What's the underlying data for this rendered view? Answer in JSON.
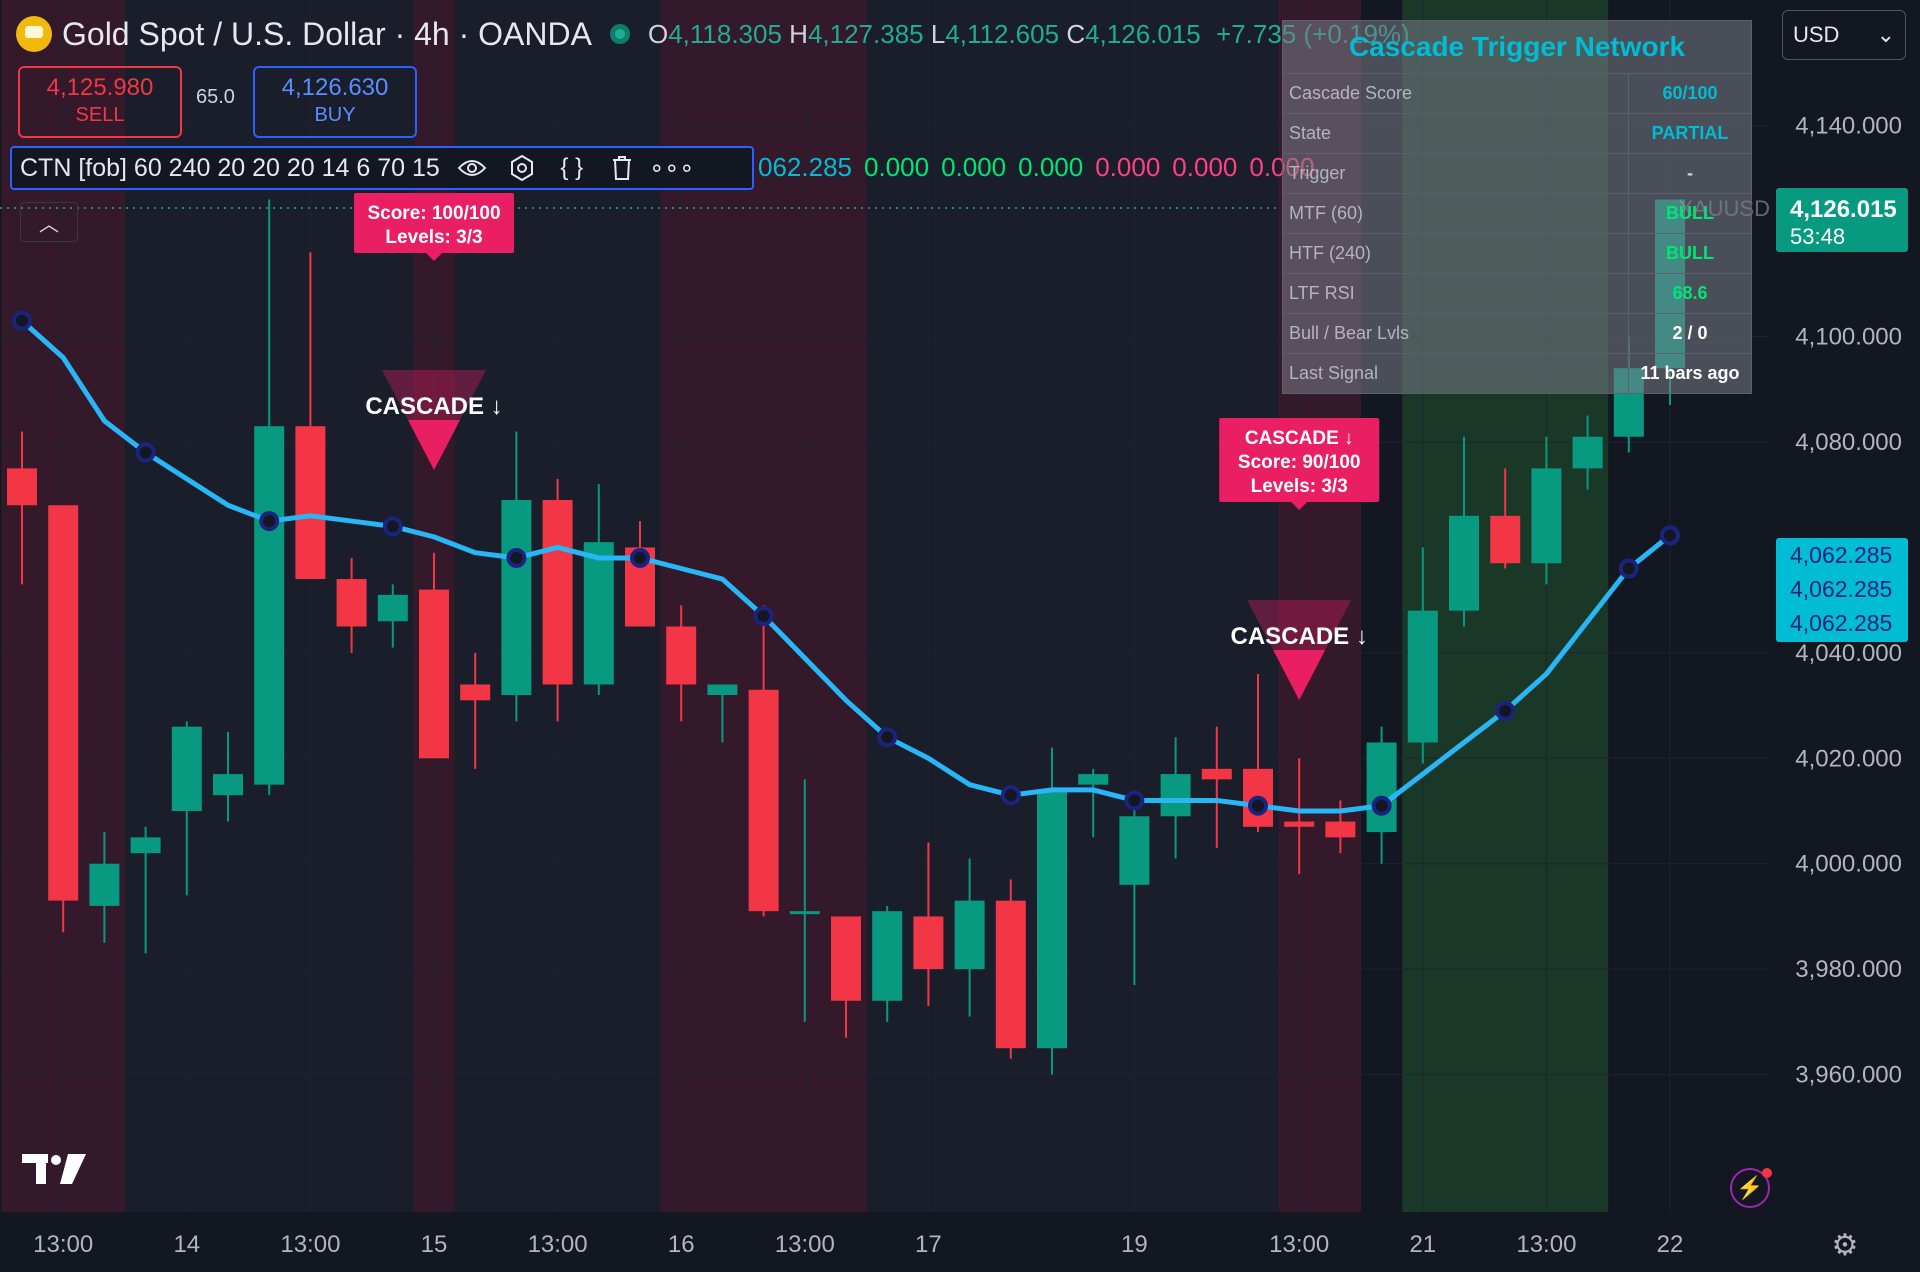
{
  "header": {
    "symbol": "Gold Spot / U.S. Dollar · 4h · OANDA",
    "open_label": "O",
    "open": "4,118.305",
    "high_label": "H",
    "high": "4,127.385",
    "low_label": "L",
    "low": "4,112.605",
    "close_label": "C",
    "close": "4,126.015",
    "change": "+7.735 (+0.19%)"
  },
  "trade": {
    "sell_price": "4,125.980",
    "sell_label": "SELL",
    "spread": "65.0",
    "buy_price": "4,126.630",
    "buy_label": "BUY"
  },
  "indicator": {
    "name": "CTN [fob] 60 240 20 20 20 14 6 70 15",
    "values": [
      "062.285",
      "0.000",
      "0.000",
      "0.000",
      "0.000",
      "0.000",
      "0.000"
    ],
    "value_colors": [
      "#00bcd4",
      "#00e676",
      "#00e676",
      "#00e676",
      "#ff4081",
      "#ff4081",
      "#ff4081"
    ]
  },
  "currency": {
    "label": "USD"
  },
  "table": {
    "title": "Cascade Trigger Network",
    "rows": [
      {
        "label": "Cascade Score",
        "value": "60/100",
        "color": "#00bcd4"
      },
      {
        "label": "State",
        "value": "PARTIAL",
        "color": "#00bcd4"
      },
      {
        "label": "Trigger",
        "value": "-",
        "color": "#d1d4dc"
      },
      {
        "label": "MTF (60)",
        "value": "BULL",
        "color": "#00e676"
      },
      {
        "label": "HTF (240)",
        "value": "BULL",
        "color": "#00e676"
      },
      {
        "label": "LTF RSI",
        "value": "68.6",
        "color": "#00e676"
      },
      {
        "label": "Bull / Bear Lvls",
        "value": "2 / 0",
        "color": "#ffffff"
      },
      {
        "label": "Last Signal",
        "value": "11 bars ago",
        "color": "#ffffff"
      }
    ]
  },
  "price_labels": {
    "last_price": "4,126.015",
    "countdown": "53:48",
    "ema_values": [
      "4,062.285",
      "4,062.285",
      "4,062.285"
    ],
    "symbol_ghost": "XAUUSD"
  },
  "chart_data": {
    "type": "candlestick",
    "y_ticks": [
      "4,140.000",
      "4,100.000",
      "4,080.000",
      "4,040.000",
      "4,020.000",
      "4,000.000",
      "3,980.000",
      "3,960.000"
    ],
    "y_tick_values": [
      4140,
      4100,
      4080,
      4040,
      4020,
      4000,
      3980,
      3960
    ],
    "x_ticks": [
      {
        "label": "13:00",
        "i": 1
      },
      {
        "label": "14",
        "i": 4
      },
      {
        "label": "13:00",
        "i": 7
      },
      {
        "label": "15",
        "i": 10
      },
      {
        "label": "13:00",
        "i": 13
      },
      {
        "label": "16",
        "i": 16
      },
      {
        "label": "13:00",
        "i": 19
      },
      {
        "label": "17",
        "i": 22
      },
      {
        "label": "19",
        "i": 27
      },
      {
        "label": "13:00",
        "i": 31
      },
      {
        "label": "21",
        "i": 34
      },
      {
        "label": "13:00",
        "i": 37
      },
      {
        "label": "22",
        "i": 40
      }
    ],
    "candles": [
      {
        "o": 4075,
        "h": 4082,
        "l": 4053,
        "c": 4068
      },
      {
        "o": 4068,
        "h": 4068,
        "l": 3987,
        "c": 3993
      },
      {
        "o": 3992,
        "h": 4006,
        "l": 3985,
        "c": 4000
      },
      {
        "o": 4002,
        "h": 4007,
        "l": 3983,
        "c": 4005
      },
      {
        "o": 4010,
        "h": 4027,
        "l": 3994,
        "c": 4026
      },
      {
        "o": 4013,
        "h": 4025,
        "l": 4008,
        "c": 4017
      },
      {
        "o": 4015,
        "h": 4126,
        "l": 4013,
        "c": 4083
      },
      {
        "o": 4083,
        "h": 4116,
        "l": 4060,
        "c": 4054
      },
      {
        "o": 4054,
        "h": 4058,
        "l": 4040,
        "c": 4045
      },
      {
        "o": 4046,
        "h": 4053,
        "l": 4041,
        "c": 4051
      },
      {
        "o": 4052,
        "h": 4059,
        "l": 4027,
        "c": 4020
      },
      {
        "o": 4034,
        "h": 4040,
        "l": 4018,
        "c": 4031
      },
      {
        "o": 4032,
        "h": 4082,
        "l": 4027,
        "c": 4069
      },
      {
        "o": 4069,
        "h": 4073,
        "l": 4027,
        "c": 4034
      },
      {
        "o": 4034,
        "h": 4072,
        "l": 4032,
        "c": 4061
      },
      {
        "o": 4060,
        "h": 4065,
        "l": 4045,
        "c": 4045
      },
      {
        "o": 4045,
        "h": 4049,
        "l": 4027,
        "c": 4034
      },
      {
        "o": 4032,
        "h": 4034,
        "l": 4023,
        "c": 4034
      },
      {
        "o": 4033,
        "h": 4049,
        "l": 3990,
        "c": 3991
      },
      {
        "o": 3991,
        "h": 4016,
        "l": 3970,
        "c": 3991
      },
      {
        "o": 3990,
        "h": 3990,
        "l": 3967,
        "c": 3974
      },
      {
        "o": 3974,
        "h": 3992,
        "l": 3970,
        "c": 3991
      },
      {
        "o": 3990,
        "h": 4004,
        "l": 3973,
        "c": 3980
      },
      {
        "o": 3980,
        "h": 4001,
        "l": 3971,
        "c": 3993
      },
      {
        "o": 3993,
        "h": 3997,
        "l": 3963,
        "c": 3965
      },
      {
        "o": 3965,
        "h": 4022,
        "l": 3960,
        "c": 4014
      },
      {
        "o": 4015,
        "h": 4018,
        "l": 4005,
        "c": 4017
      },
      {
        "o": 3996,
        "h": 4013,
        "l": 3977,
        "c": 4009
      },
      {
        "o": 4009,
        "h": 4024,
        "l": 4001,
        "c": 4017
      },
      {
        "o": 4018,
        "h": 4026,
        "l": 4003,
        "c": 4016
      },
      {
        "o": 4018,
        "h": 4036,
        "l": 4006,
        "c": 4007
      },
      {
        "o": 4008,
        "h": 4020,
        "l": 3998,
        "c": 4007
      },
      {
        "o": 4008,
        "h": 4012,
        "l": 4002,
        "c": 4005
      },
      {
        "o": 4006,
        "h": 4026,
        "l": 4000,
        "c": 4023
      },
      {
        "o": 4023,
        "h": 4060,
        "l": 4019,
        "c": 4048
      },
      {
        "o": 4048,
        "h": 4081,
        "l": 4045,
        "c": 4066
      },
      {
        "o": 4066,
        "h": 4075,
        "l": 4056,
        "c": 4057
      },
      {
        "o": 4057,
        "h": 4081,
        "l": 4053,
        "c": 4075
      },
      {
        "o": 4075,
        "h": 4085,
        "l": 4071,
        "c": 4081
      },
      {
        "o": 4081,
        "h": 4100,
        "l": 4078,
        "c": 4094
      },
      {
        "o": 4094,
        "h": 4105,
        "l": 4087,
        "c": 4126
      }
    ],
    "ema": [
      4103,
      4096,
      4084,
      4078,
      4073,
      4068,
      4065,
      4066,
      4065,
      4064,
      4062,
      4059,
      4058,
      4060,
      4058,
      4058,
      4056,
      4054,
      4047,
      4039,
      4031,
      4024,
      4020,
      4015,
      4013,
      4014,
      4014,
      4012,
      4012,
      4012,
      4011,
      4010,
      4010,
      4011,
      4017,
      4023,
      4029,
      4036,
      4046,
      4056,
      4062.285
    ],
    "bg_bands": [
      {
        "from": 0,
        "to": 3,
        "color": "rgba(120,30,60,0.32)"
      },
      {
        "from": 3,
        "to": 10,
        "color": "rgba(40,44,60,0.35)"
      },
      {
        "from": 10,
        "to": 11,
        "color": "rgba(120,30,60,0.32)"
      },
      {
        "from": 11,
        "to": 16,
        "color": "rgba(40,44,60,0.35)"
      },
      {
        "from": 16,
        "to": 21,
        "color": "rgba(120,30,60,0.32)"
      },
      {
        "from": 21,
        "to": 31,
        "color": "rgba(40,44,60,0.35)"
      },
      {
        "from": 31,
        "to": 33,
        "color": "rgba(120,30,60,0.32)"
      },
      {
        "from": 34,
        "to": 39,
        "color": "rgba(40,110,50,0.38)"
      }
    ],
    "signals": [
      {
        "i": 10,
        "label": "CASCADE ↓",
        "box_lines": [
          "Score: 100/100",
          "Levels: 3/3"
        ],
        "box_high": true
      },
      {
        "i": 31,
        "label": "CASCADE ↓",
        "box_lines": [
          "CASCADE ↓",
          "Score: 90/100",
          "Levels: 3/3"
        ],
        "box_high": false
      }
    ],
    "colors": {
      "up": "#089981",
      "down": "#f23645",
      "ema": "#29b6f6",
      "signal": "#e91e63"
    }
  }
}
